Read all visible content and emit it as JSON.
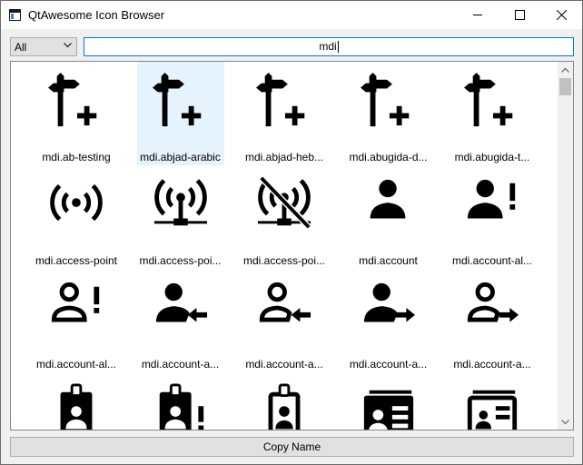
{
  "window": {
    "title": "QtAwesome Icon Browser"
  },
  "toolbar": {
    "filter_selected": "All",
    "search_value": "mdi"
  },
  "icons": [
    {
      "label": "mdi.ab-testing",
      "icon": "sign-plus-icon"
    },
    {
      "label": "mdi.abjad-arabic",
      "icon": "sign-plus-icon"
    },
    {
      "label": "mdi.abjad-heb...",
      "icon": "sign-plus-icon"
    },
    {
      "label": "mdi.abugida-d...",
      "icon": "sign-plus-icon"
    },
    {
      "label": "mdi.abugida-t...",
      "icon": "sign-plus-icon"
    },
    {
      "label": "mdi.access-point",
      "icon": "access-point-icon"
    },
    {
      "label": "mdi.access-poi...",
      "icon": "access-point-network-icon"
    },
    {
      "label": "mdi.access-poi...",
      "icon": "access-point-network-off-icon"
    },
    {
      "label": "mdi.account",
      "icon": "account-icon"
    },
    {
      "label": "mdi.account-al...",
      "icon": "account-alert-icon"
    },
    {
      "label": "mdi.account-al...",
      "icon": "account-alert-outline-icon"
    },
    {
      "label": "mdi.account-a...",
      "icon": "account-arrow-left-icon"
    },
    {
      "label": "mdi.account-a...",
      "icon": "account-arrow-left-outline-icon"
    },
    {
      "label": "mdi.account-a...",
      "icon": "account-arrow-right-icon"
    },
    {
      "label": "mdi.account-a...",
      "icon": "account-arrow-right-outline-icon"
    },
    {
      "label": "",
      "icon": "account-badge-icon"
    },
    {
      "label": "",
      "icon": "account-badge-alert-icon"
    },
    {
      "label": "",
      "icon": "account-badge-outline-icon"
    },
    {
      "label": "",
      "icon": "account-box-multiple-icon"
    },
    {
      "label": "",
      "icon": "account-box-multiple-outline-icon"
    }
  ],
  "selected_index": 1,
  "footer": {
    "copy_label": "Copy Name"
  },
  "colors": {
    "selection": "#e5f3ff",
    "accent": "#0078d7"
  }
}
